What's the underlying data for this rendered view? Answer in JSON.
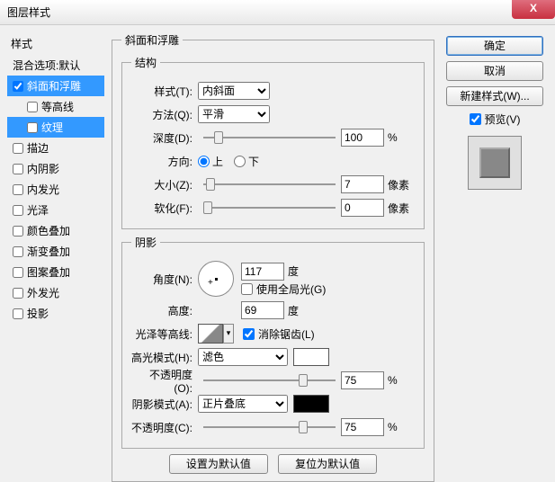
{
  "title": "图层样式",
  "sidebar": {
    "header": "样式",
    "items": [
      {
        "label": "混合选项:默认",
        "ck": false,
        "indent": false,
        "noCk": true
      },
      {
        "label": "斜面和浮雕",
        "ck": true,
        "indent": false,
        "sel": true
      },
      {
        "label": "等高线",
        "ck": false,
        "indent": true
      },
      {
        "label": "纹理",
        "ck": false,
        "indent": true,
        "sel": true
      },
      {
        "label": "描边",
        "ck": false,
        "indent": false
      },
      {
        "label": "内阴影",
        "ck": false,
        "indent": false
      },
      {
        "label": "内发光",
        "ck": false,
        "indent": false
      },
      {
        "label": "光泽",
        "ck": false,
        "indent": false
      },
      {
        "label": "颜色叠加",
        "ck": false,
        "indent": false
      },
      {
        "label": "渐变叠加",
        "ck": false,
        "indent": false
      },
      {
        "label": "图案叠加",
        "ck": false,
        "indent": false
      },
      {
        "label": "外发光",
        "ck": false,
        "indent": false
      },
      {
        "label": "投影",
        "ck": false,
        "indent": false
      }
    ]
  },
  "groupTitle": "斜面和浮雕",
  "struct": {
    "title": "结构",
    "styleLbl": "样式(T):",
    "styleVal": "内斜面",
    "methodLbl": "方法(Q):",
    "methodVal": "平滑",
    "depthLbl": "深度(D):",
    "depthVal": "100",
    "pct": "%",
    "dirLbl": "方向:",
    "up": "上",
    "down": "下",
    "sizeLbl": "大小(Z):",
    "sizeVal": "7",
    "px": "像素",
    "softLbl": "软化(F):",
    "softVal": "0"
  },
  "shadow": {
    "title": "阴影",
    "angleLbl": "角度(N):",
    "angleVal": "117",
    "deg": "度",
    "globalLbl": "使用全局光(G)",
    "altLbl": "高度:",
    "altVal": "69",
    "glossLbl": "光泽等高线:",
    "aaLbl": "消除锯齿(L)",
    "hiLbl": "高光模式(H):",
    "hiMode": "滤色",
    "opLbl": "不透明度(O):",
    "opVal": "75",
    "shLbl": "阴影模式(A):",
    "shMode": "正片叠底",
    "opLbl2": "不透明度(C):",
    "opVal2": "75"
  },
  "buttons": {
    "default": "设置为默认值",
    "reset": "复位为默认值"
  },
  "right": {
    "ok": "确定",
    "cancel": "取消",
    "newStyle": "新建样式(W)...",
    "preview": "预览(V)"
  }
}
